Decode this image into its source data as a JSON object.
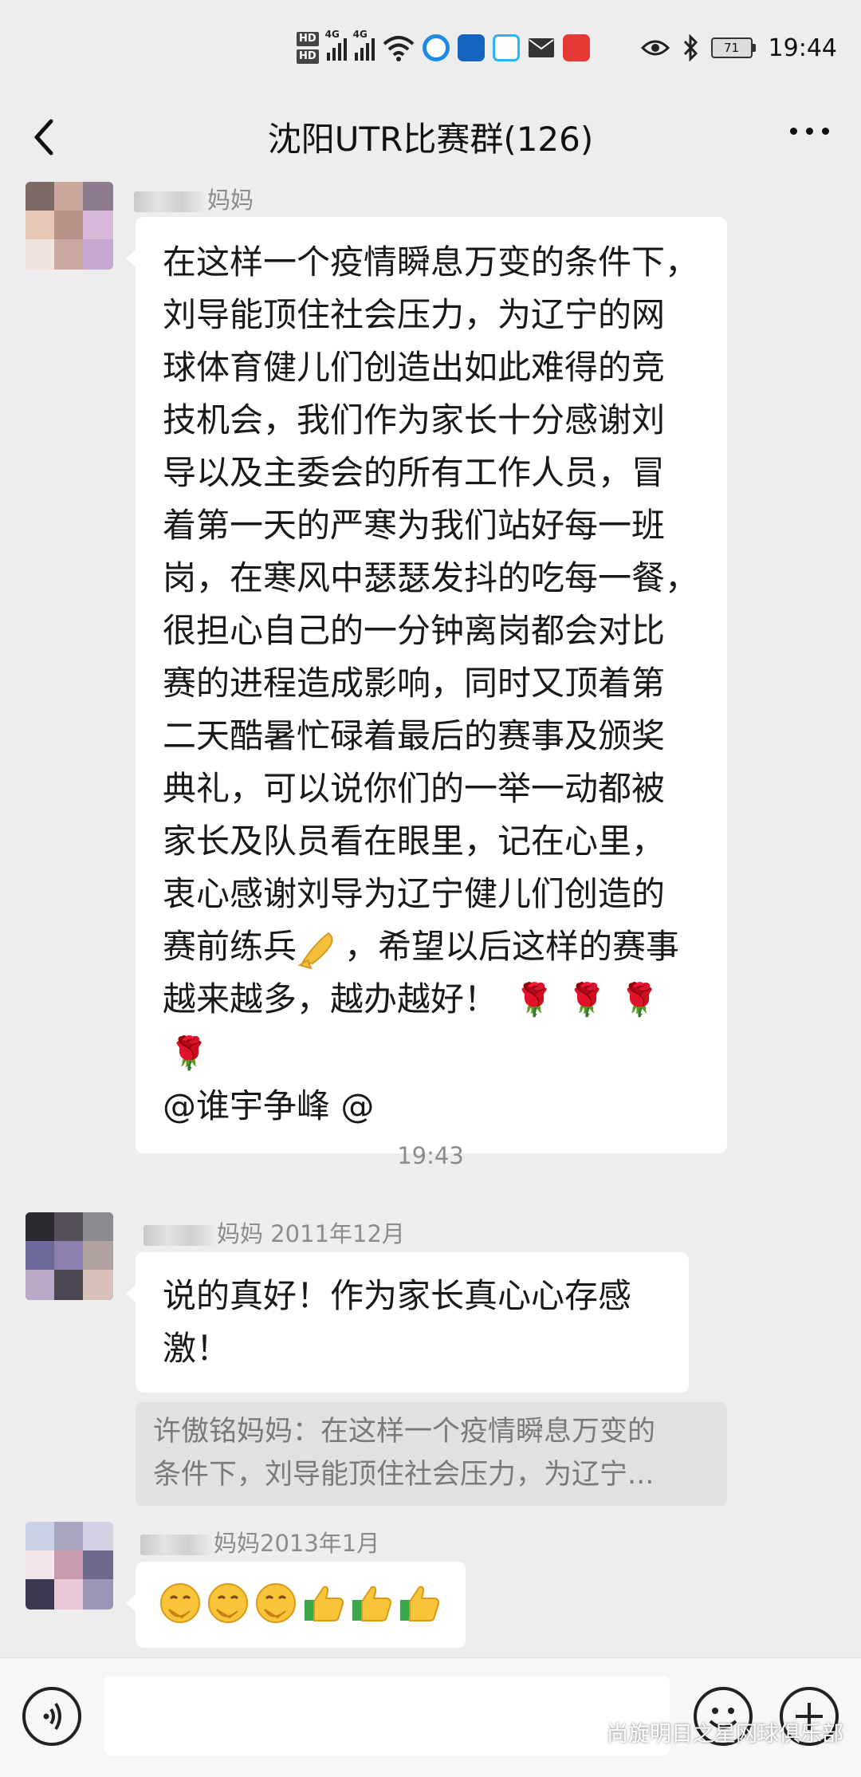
{
  "status_bar": {
    "hd1": "HD",
    "hd2": "HD",
    "net1": "4G",
    "net2": "4G",
    "battery": "71",
    "time": "19:44",
    "icons": [
      "wifi-icon",
      "app-icon",
      "hongmeng-app-icon",
      "cloud-app-icon",
      "mail-icon",
      "huawei-app-icon",
      "eye-icon",
      "bluetooth-icon"
    ]
  },
  "header": {
    "title": "沈阳UTR比赛群(126)"
  },
  "messages": [
    {
      "sender_suffix": "妈妈",
      "lines": [
        "在这样一个疫情瞬息万变的条件下，",
        "刘导能顶住社会压力，为辽宁的网",
        "球体育健儿们创造出如此难得的竞",
        "技机会，我们作为家长十分感谢刘",
        "导以及主委会的所有工作人员，冒",
        "着第一天的严寒为我们站好每一班",
        "岗，在寒风中瑟瑟发抖的吃每一餐，",
        "很担心自己的一分钟离岗都会对比",
        "赛的进程造成影响，同时又顶着第",
        "二天酷暑忙碌着最后的赛事及颁奖",
        "典礼，可以说你们的一举一动都被",
        "家长及队员看在眼里，记在心里，",
        "衷心感谢刘导为辽宁健儿们创造的"
      ],
      "line14_a": "赛前练兵",
      "line14_b": "，希望以后这样的赛事",
      "line15": "越来越多，越办越好！",
      "line16": "@谁宇争峰 @"
    },
    {
      "sender_suffix": "妈妈 2011年12月",
      "lines": [
        "说的真好！作为家长真心心存感",
        "激！"
      ],
      "quote": [
        "许傲铭妈妈：在这样一个疫情瞬息万变的",
        "条件下，刘导能顶住社会压力，为辽宁..."
      ]
    },
    {
      "sender_suffix": "妈妈2013年1月"
    }
  ],
  "timestamp": "19:43",
  "watermark": "尚旋明日之星网球俱乐部",
  "colors": {
    "background": "#ededed",
    "bubble": "#ffffff",
    "quote_bg": "#e1e1e1",
    "rose": "#c0131b"
  }
}
